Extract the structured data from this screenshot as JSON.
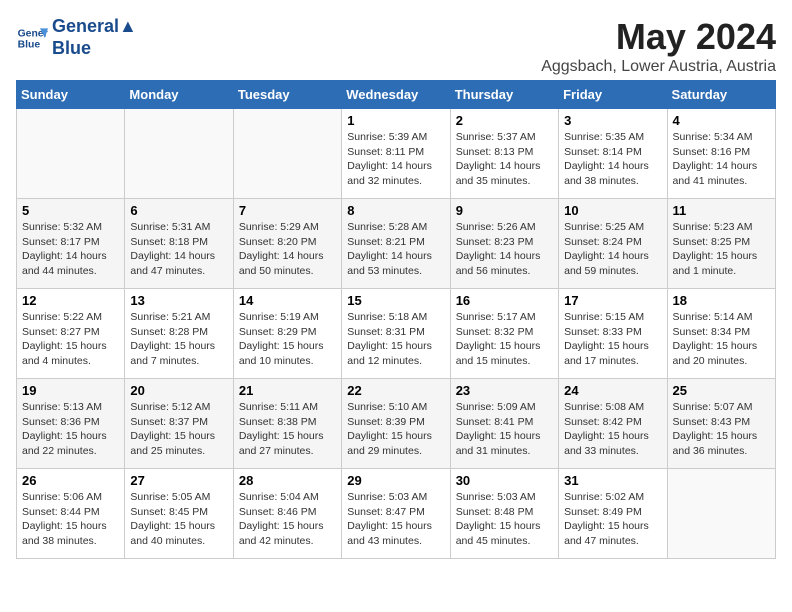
{
  "logo": {
    "line1": "General",
    "line2": "Blue"
  },
  "title": "May 2024",
  "subtitle": "Aggsbach, Lower Austria, Austria",
  "days_of_week": [
    "Sunday",
    "Monday",
    "Tuesday",
    "Wednesday",
    "Thursday",
    "Friday",
    "Saturday"
  ],
  "weeks": [
    [
      {
        "day": "",
        "info": ""
      },
      {
        "day": "",
        "info": ""
      },
      {
        "day": "",
        "info": ""
      },
      {
        "day": "1",
        "info": "Sunrise: 5:39 AM\nSunset: 8:11 PM\nDaylight: 14 hours and 32 minutes."
      },
      {
        "day": "2",
        "info": "Sunrise: 5:37 AM\nSunset: 8:13 PM\nDaylight: 14 hours and 35 minutes."
      },
      {
        "day": "3",
        "info": "Sunrise: 5:35 AM\nSunset: 8:14 PM\nDaylight: 14 hours and 38 minutes."
      },
      {
        "day": "4",
        "info": "Sunrise: 5:34 AM\nSunset: 8:16 PM\nDaylight: 14 hours and 41 minutes."
      }
    ],
    [
      {
        "day": "5",
        "info": "Sunrise: 5:32 AM\nSunset: 8:17 PM\nDaylight: 14 hours and 44 minutes."
      },
      {
        "day": "6",
        "info": "Sunrise: 5:31 AM\nSunset: 8:18 PM\nDaylight: 14 hours and 47 minutes."
      },
      {
        "day": "7",
        "info": "Sunrise: 5:29 AM\nSunset: 8:20 PM\nDaylight: 14 hours and 50 minutes."
      },
      {
        "day": "8",
        "info": "Sunrise: 5:28 AM\nSunset: 8:21 PM\nDaylight: 14 hours and 53 minutes."
      },
      {
        "day": "9",
        "info": "Sunrise: 5:26 AM\nSunset: 8:23 PM\nDaylight: 14 hours and 56 minutes."
      },
      {
        "day": "10",
        "info": "Sunrise: 5:25 AM\nSunset: 8:24 PM\nDaylight: 14 hours and 59 minutes."
      },
      {
        "day": "11",
        "info": "Sunrise: 5:23 AM\nSunset: 8:25 PM\nDaylight: 15 hours and 1 minute."
      }
    ],
    [
      {
        "day": "12",
        "info": "Sunrise: 5:22 AM\nSunset: 8:27 PM\nDaylight: 15 hours and 4 minutes."
      },
      {
        "day": "13",
        "info": "Sunrise: 5:21 AM\nSunset: 8:28 PM\nDaylight: 15 hours and 7 minutes."
      },
      {
        "day": "14",
        "info": "Sunrise: 5:19 AM\nSunset: 8:29 PM\nDaylight: 15 hours and 10 minutes."
      },
      {
        "day": "15",
        "info": "Sunrise: 5:18 AM\nSunset: 8:31 PM\nDaylight: 15 hours and 12 minutes."
      },
      {
        "day": "16",
        "info": "Sunrise: 5:17 AM\nSunset: 8:32 PM\nDaylight: 15 hours and 15 minutes."
      },
      {
        "day": "17",
        "info": "Sunrise: 5:15 AM\nSunset: 8:33 PM\nDaylight: 15 hours and 17 minutes."
      },
      {
        "day": "18",
        "info": "Sunrise: 5:14 AM\nSunset: 8:34 PM\nDaylight: 15 hours and 20 minutes."
      }
    ],
    [
      {
        "day": "19",
        "info": "Sunrise: 5:13 AM\nSunset: 8:36 PM\nDaylight: 15 hours and 22 minutes."
      },
      {
        "day": "20",
        "info": "Sunrise: 5:12 AM\nSunset: 8:37 PM\nDaylight: 15 hours and 25 minutes."
      },
      {
        "day": "21",
        "info": "Sunrise: 5:11 AM\nSunset: 8:38 PM\nDaylight: 15 hours and 27 minutes."
      },
      {
        "day": "22",
        "info": "Sunrise: 5:10 AM\nSunset: 8:39 PM\nDaylight: 15 hours and 29 minutes."
      },
      {
        "day": "23",
        "info": "Sunrise: 5:09 AM\nSunset: 8:41 PM\nDaylight: 15 hours and 31 minutes."
      },
      {
        "day": "24",
        "info": "Sunrise: 5:08 AM\nSunset: 8:42 PM\nDaylight: 15 hours and 33 minutes."
      },
      {
        "day": "25",
        "info": "Sunrise: 5:07 AM\nSunset: 8:43 PM\nDaylight: 15 hours and 36 minutes."
      }
    ],
    [
      {
        "day": "26",
        "info": "Sunrise: 5:06 AM\nSunset: 8:44 PM\nDaylight: 15 hours and 38 minutes."
      },
      {
        "day": "27",
        "info": "Sunrise: 5:05 AM\nSunset: 8:45 PM\nDaylight: 15 hours and 40 minutes."
      },
      {
        "day": "28",
        "info": "Sunrise: 5:04 AM\nSunset: 8:46 PM\nDaylight: 15 hours and 42 minutes."
      },
      {
        "day": "29",
        "info": "Sunrise: 5:03 AM\nSunset: 8:47 PM\nDaylight: 15 hours and 43 minutes."
      },
      {
        "day": "30",
        "info": "Sunrise: 5:03 AM\nSunset: 8:48 PM\nDaylight: 15 hours and 45 minutes."
      },
      {
        "day": "31",
        "info": "Sunrise: 5:02 AM\nSunset: 8:49 PM\nDaylight: 15 hours and 47 minutes."
      },
      {
        "day": "",
        "info": ""
      }
    ]
  ]
}
